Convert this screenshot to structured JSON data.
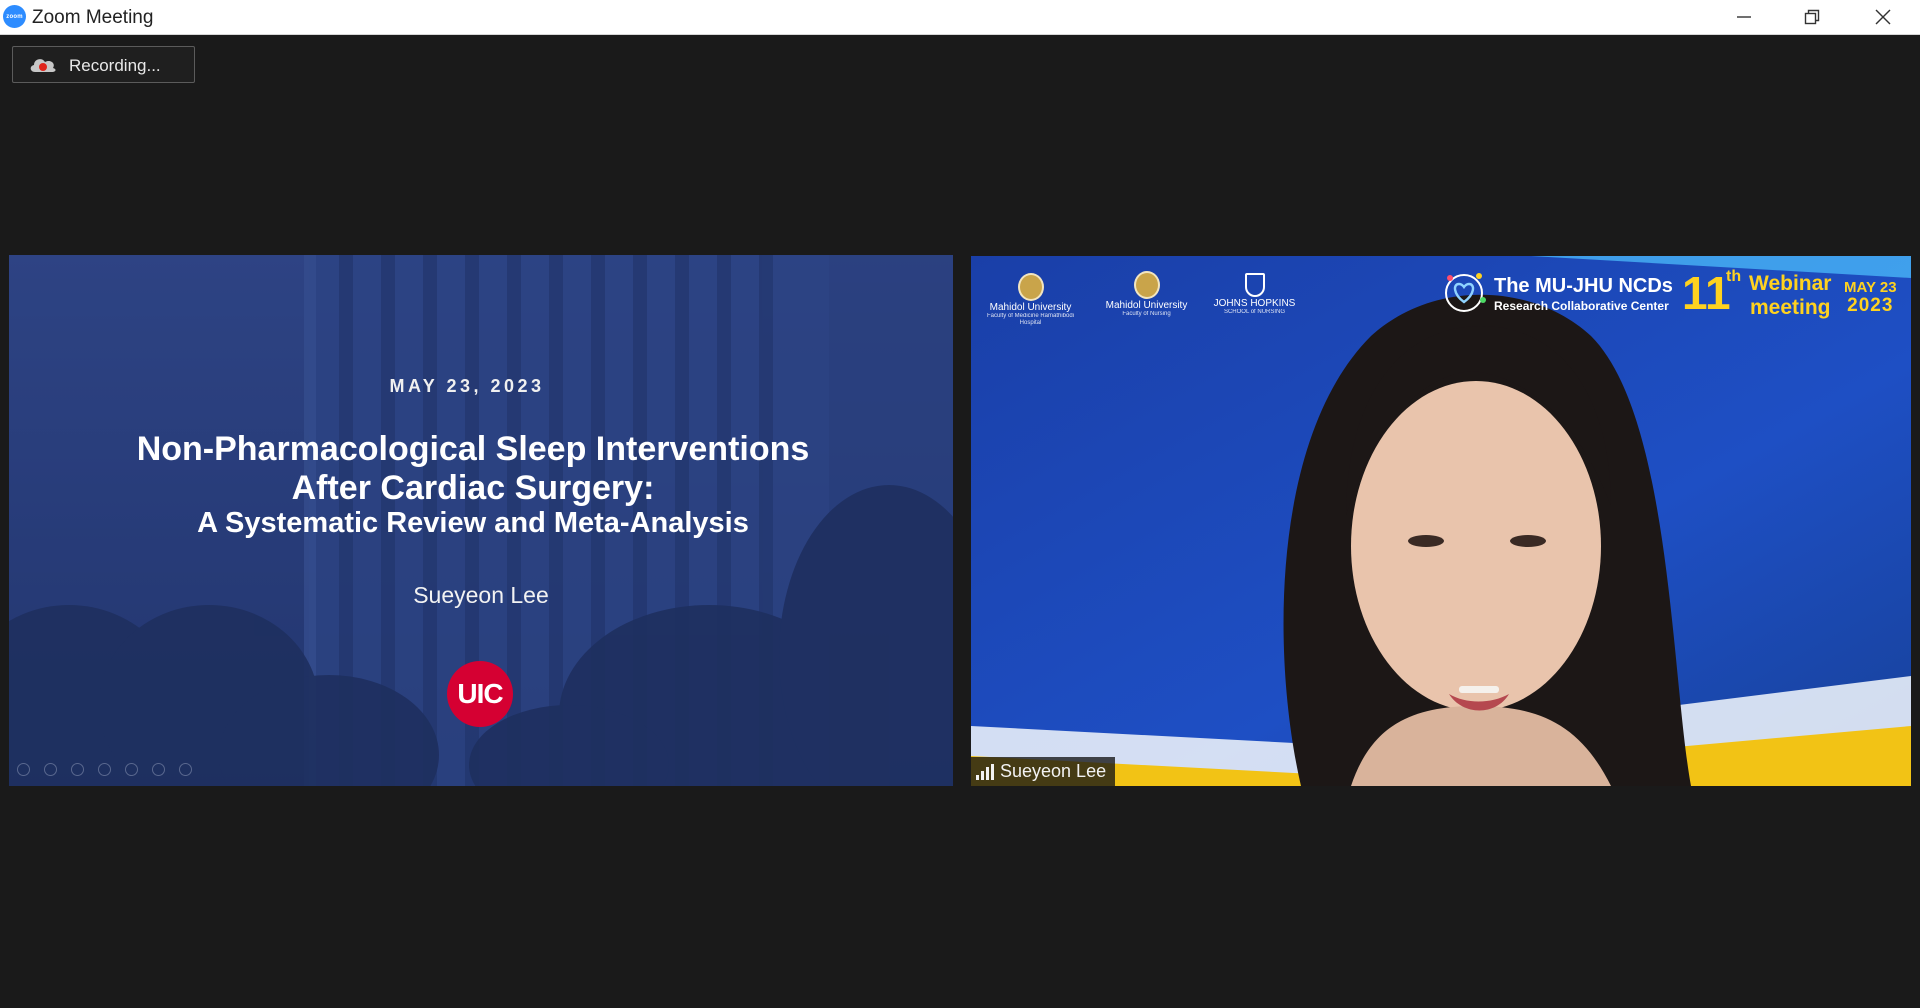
{
  "window": {
    "title": "Zoom Meeting",
    "app_icon_label": "zoom"
  },
  "recording": {
    "label": "Recording..."
  },
  "shared_screen": {
    "date": "MAY 23, 2023",
    "title_line_1": "Non-Pharmacological Sleep Interventions",
    "title_line_2": "After Cardiac Surgery:",
    "title_line_3": "A Systematic Review and Meta-Analysis",
    "author": "Sueyeon Lee",
    "logo": "UIC"
  },
  "speaker_video": {
    "participant_name": "Sueyeon Lee",
    "logos": [
      {
        "name": "Mahidol University",
        "sub": "Faculty of Medicine Ramathibodi Hospital"
      },
      {
        "name": "Mahidol University",
        "sub": "Faculty of Nursing"
      },
      {
        "name": "JOHNS HOPKINS",
        "sub": "SCHOOL of NURSING"
      }
    ],
    "banner": {
      "title": "The MU-JHU NCDs",
      "subtitle": "Research Collaborative Center",
      "edition_number": "11",
      "edition_suffix": "th",
      "event_line_1": "Webinar",
      "event_line_2": "meeting",
      "date_line_1": "MAY 23",
      "date_line_2": "2023"
    }
  },
  "colors": {
    "background": "#1a1a1a",
    "zoom_blue": "#2d8cff",
    "uic_red": "#d50032",
    "banner_yellow": "#ffd21f",
    "video_blue": "#1c48b8"
  },
  "icons": {
    "minimize": "minimize-icon",
    "restore": "restore-icon",
    "close": "close-icon",
    "recording": "cloud-recording-icon",
    "signal": "signal-strength-icon"
  }
}
